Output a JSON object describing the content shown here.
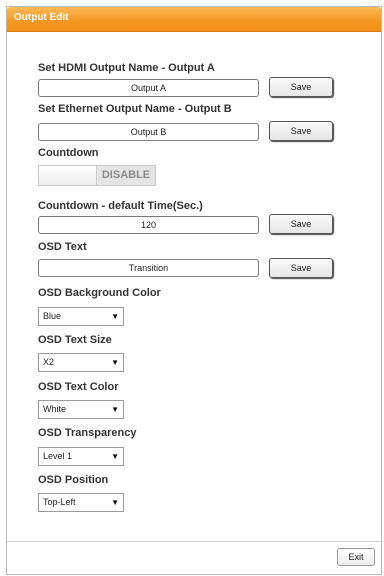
{
  "window": {
    "title": "Output Edit"
  },
  "hdmi": {
    "label": "Set HDMI Output Name - Output A",
    "value": "Output A",
    "save_label": "Save"
  },
  "ethernet": {
    "label": "Set Ethernet Output Name - Output B",
    "value": "Output B",
    "save_label": "Save"
  },
  "countdown": {
    "label": "Countdown",
    "state": "DISABLE"
  },
  "countdown_time": {
    "label": "Countdown - default Time(Sec.)",
    "value": "120",
    "save_label": "Save"
  },
  "osd_text": {
    "label": "OSD Text",
    "value": "Transition",
    "save_label": "Save"
  },
  "osd_bg_color": {
    "label": "OSD Background Color",
    "selected": "Blue"
  },
  "osd_text_size": {
    "label": "OSD Text Size",
    "selected": "X2"
  },
  "osd_text_color": {
    "label": "OSD Text Color",
    "selected": "White"
  },
  "osd_transparency": {
    "label": "OSD Transparency",
    "selected": "Level 1"
  },
  "osd_position": {
    "label": "OSD Position",
    "selected": "Top-Left"
  },
  "footer": {
    "exit_label": "Exit"
  },
  "icons": {
    "dropdown_arrow": "chevron-down-icon"
  },
  "colors": {
    "title_bar": "#f59a25",
    "title_text": "#ffffff"
  }
}
